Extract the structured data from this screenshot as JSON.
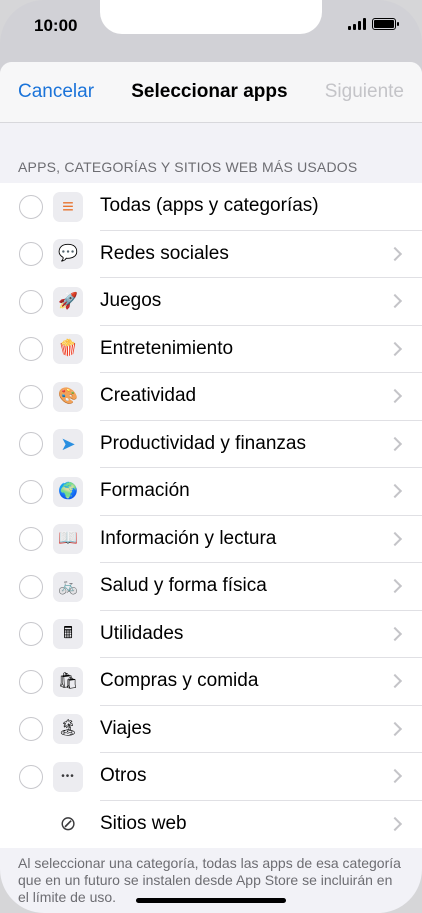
{
  "status_bar": {
    "time": "10:00",
    "signal_icon": "cellular-signal-icon",
    "battery_icon": "battery-full-icon"
  },
  "navbar": {
    "cancel_label": "Cancelar",
    "title": "Seleccionar apps",
    "next_label": "Siguiente",
    "accent_color": "#1a73d9",
    "disabled_color": "#c4c4c8"
  },
  "section": {
    "header": "APPS, CATEGORÍAS Y SITIOS WEB MÁS USADOS"
  },
  "categories": [
    {
      "label": "Todas (apps y categorías)",
      "icon": "stack-layers-icon",
      "glyph": "≡",
      "selectable": true,
      "chevron": false
    },
    {
      "label": "Redes sociales",
      "icon": "chat-bubbles-icon",
      "glyph": "💬",
      "selectable": true,
      "chevron": true
    },
    {
      "label": "Juegos",
      "icon": "rocket-icon",
      "glyph": "🚀",
      "selectable": true,
      "chevron": true
    },
    {
      "label": "Entretenimiento",
      "icon": "popcorn-icon",
      "glyph": "🍿",
      "selectable": true,
      "chevron": true
    },
    {
      "label": "Creatividad",
      "icon": "paint-palette-icon",
      "glyph": "🎨",
      "selectable": true,
      "chevron": true
    },
    {
      "label": "Productividad y finanzas",
      "icon": "paper-plane-icon",
      "glyph": "➤",
      "selectable": true,
      "chevron": true
    },
    {
      "label": "Formación",
      "icon": "globe-icon",
      "glyph": "🌍",
      "selectable": true,
      "chevron": true
    },
    {
      "label": "Información y lectura",
      "icon": "open-book-icon",
      "glyph": "📖",
      "selectable": true,
      "chevron": true
    },
    {
      "label": "Salud y forma física",
      "icon": "bicycle-icon",
      "glyph": "🚲",
      "selectable": true,
      "chevron": true
    },
    {
      "label": "Utilidades",
      "icon": "calculator-icon",
      "glyph": "🖩",
      "selectable": true,
      "chevron": true
    },
    {
      "label": "Compras y comida",
      "icon": "shopping-bag-icon",
      "glyph": "🛍",
      "selectable": true,
      "chevron": true
    },
    {
      "label": "Viajes",
      "icon": "palm-tree-island-icon",
      "glyph": "🏝",
      "selectable": true,
      "chevron": true
    },
    {
      "label": "Otros",
      "icon": "ellipsis-icon",
      "glyph": "•••",
      "selectable": true,
      "chevron": true
    },
    {
      "label": "Sitios web",
      "icon": "compass-icon",
      "glyph": "⊘",
      "selectable": false,
      "chevron": true
    }
  ],
  "footer": {
    "text": "Al seleccionar una categoría, todas las apps de esa categoría que en un futuro se instalen desde App Store se incluirán en el límite de uso."
  }
}
